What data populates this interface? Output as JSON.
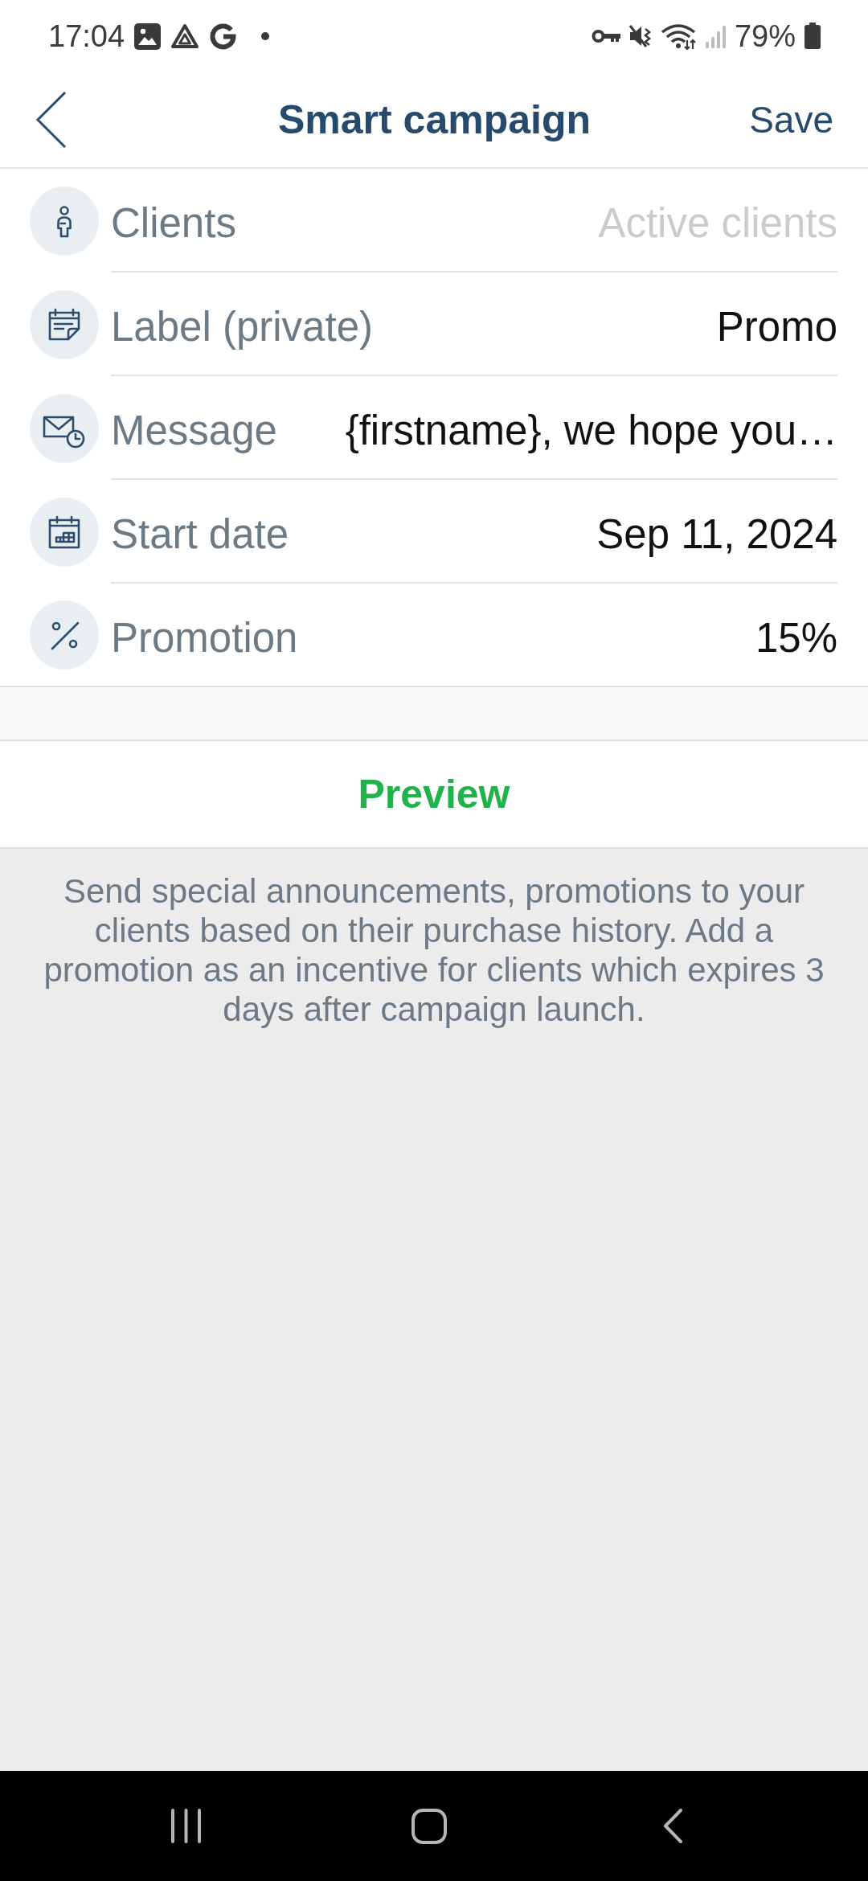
{
  "status_bar": {
    "time": "17:04",
    "battery": "79%"
  },
  "header": {
    "title": "Smart campaign",
    "action": "Save"
  },
  "fields": [
    {
      "kind": "clients",
      "label": "Clients",
      "placeholder": "Active clients"
    },
    {
      "kind": "label",
      "label": "Label (private)",
      "value": "Promo"
    },
    {
      "kind": "message",
      "label": "Message",
      "value": "{firstname}, we hope you…"
    },
    {
      "kind": "date",
      "label": "Start date",
      "value": "Sep 11, 2024"
    },
    {
      "kind": "promotion",
      "label": "Promotion",
      "value": "15%"
    }
  ],
  "preview_button": "Preview",
  "description": "Send special announcements, promotions to your clients based on their purchase history. Add a promotion as an incentive for clients which expires 3 days after campaign launch."
}
